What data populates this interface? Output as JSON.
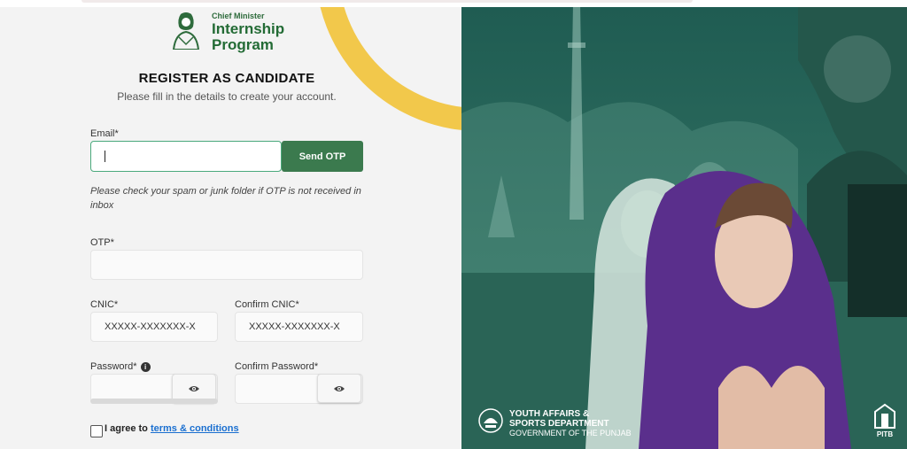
{
  "logo": {
    "small": "Chief Minister",
    "line1": "Internship",
    "line2": "Program"
  },
  "title": "REGISTER AS CANDIDATE",
  "subtitle": "Please fill in the details to create your account.",
  "email": {
    "label": "Email*",
    "value": ""
  },
  "otp_button": "Send OTP",
  "note": "Please check your spam or junk folder if OTP is not received in inbox",
  "otp": {
    "label": "OTP*",
    "value": ""
  },
  "cnic": {
    "label": "CNIC*",
    "placeholder": "XXXXX-XXXXXXX-X"
  },
  "confirm_cnic": {
    "label": "Confirm CNIC*",
    "placeholder": "XXXXX-XXXXXXX-X"
  },
  "password": {
    "label": "Password*",
    "info_icon": "info-icon"
  },
  "confirm_password": {
    "label": "Confirm Password*"
  },
  "agree": {
    "text": "I agree to",
    "link": "terms & conditions"
  },
  "footer": {
    "dept_line1": "YOUTH AFFAIRS &",
    "dept_line2": "SPORTS DEPARTMENT",
    "gov": "GOVERNMENT OF THE PUNJAB",
    "pitb": "PITB"
  },
  "colors": {
    "brand_green": "#3b7a4e",
    "accent_yellow": "#f2c84b",
    "panel_teal": "#2d6b5d",
    "link_blue": "#1a6fd0"
  }
}
